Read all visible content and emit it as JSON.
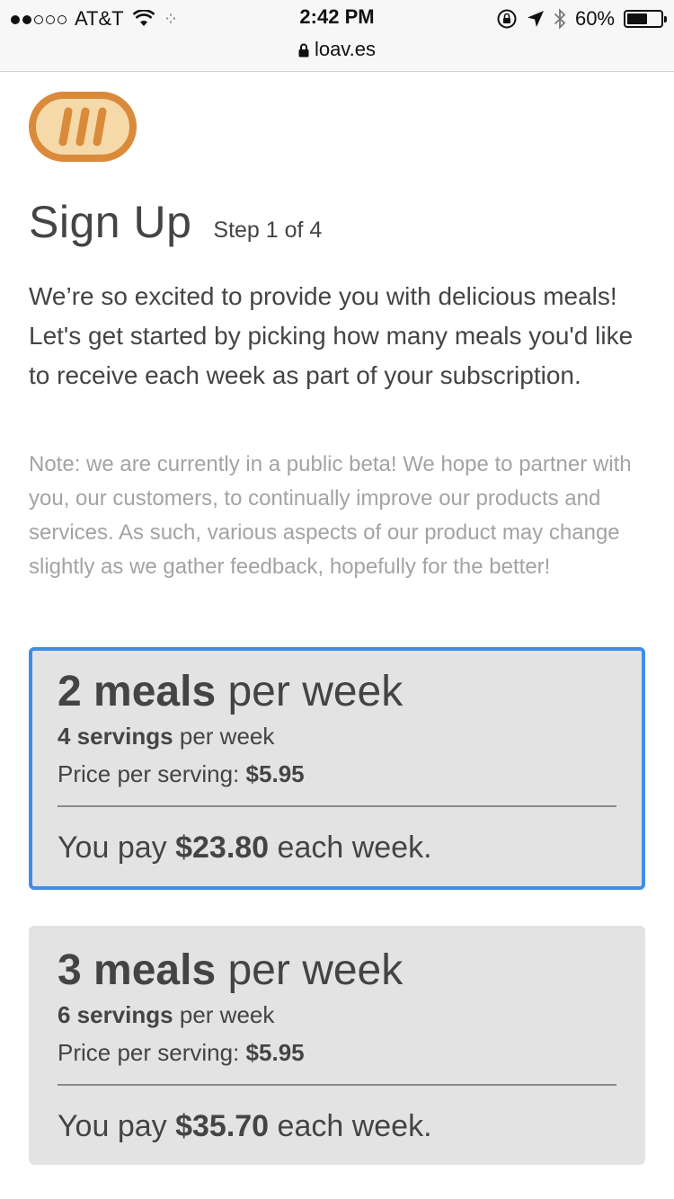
{
  "status_bar": {
    "carrier": "AT&T",
    "time": "2:42 PM",
    "url": "loav.es",
    "battery": "60%",
    "battery_level": 0.6,
    "signal_dots": [
      true,
      true,
      false,
      false,
      false
    ]
  },
  "brand": {
    "logo_icon": "loaves-bread-logo",
    "logo_color": "#d98a3a"
  },
  "header": {
    "title": "Sign Up",
    "step": "Step 1 of 4"
  },
  "intro": "We’re so excited to provide you with delicious meals! Let's get started by picking how many meals you'd like to receive each week as part of your subscription.",
  "note": "Note: we are currently in a public beta! We hope to partner with you, our customers, to continually improve our products and services. As such, various aspects of our product may change slightly as we gather feedback, hopefully for the better!",
  "plans": [
    {
      "selected": true,
      "meals": "2 meals",
      "meals_suffix": "per week",
      "servings": "4 servings",
      "servings_suffix": "per week",
      "price_label": "Price per serving:",
      "price": "$5.95",
      "pay_prefix": "You pay",
      "pay_amount": "$23.80",
      "pay_suffix": "each week."
    },
    {
      "selected": false,
      "meals": "3 meals",
      "meals_suffix": "per week",
      "servings": "6 servings",
      "servings_suffix": "per week",
      "price_label": "Price per serving:",
      "price": "$5.95",
      "pay_prefix": "You pay",
      "pay_amount": "$35.70",
      "pay_suffix": "each week."
    }
  ],
  "colors": {
    "accent_border": "#3d8ee8",
    "card_bg": "#e3e3e3",
    "note_text": "#a3a3a3"
  }
}
